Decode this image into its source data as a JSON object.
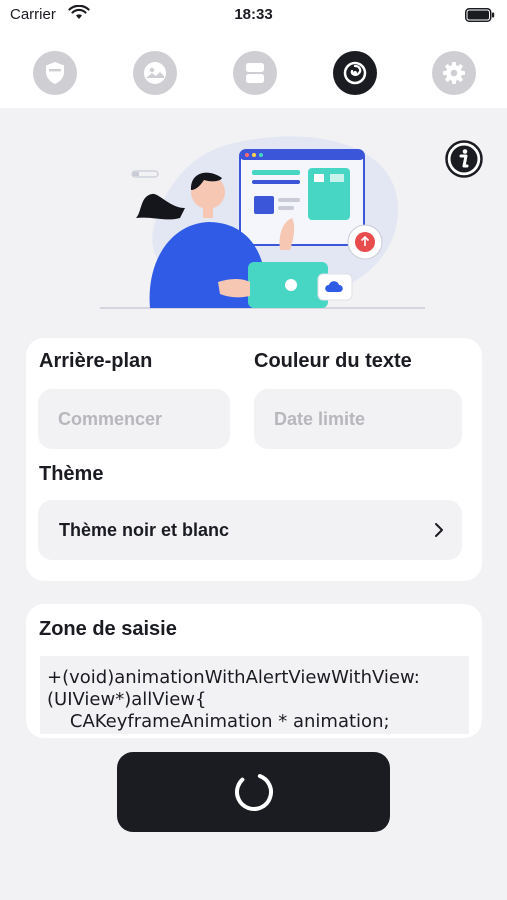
{
  "status_bar": {
    "carrier": "Carrier",
    "time": "18:33"
  },
  "tabs": [
    {
      "icon": "shield-icon",
      "active": false
    },
    {
      "icon": "image-icon",
      "active": false
    },
    {
      "icon": "layers-icon",
      "active": false
    },
    {
      "icon": "swirl-icon",
      "active": true
    },
    {
      "icon": "gear-icon",
      "active": false
    }
  ],
  "settings": {
    "background_label": "Arrière-plan",
    "background_placeholder": "Commencer",
    "text_color_label": "Couleur du texte",
    "text_color_placeholder": "Date limite",
    "theme_label": "Thème",
    "theme_value": "Thème noir et blanc"
  },
  "input_zone": {
    "label": "Zone de saisie",
    "lines": [
      "+(void)animationWithAlertViewWithView:",
      "(UIView*)allView{",
      "    CAKeyframeAnimation * animation;"
    ]
  },
  "colors": {
    "accent": "#1b1c22",
    "background": "#f2f2f4",
    "illustration_blue": "#2f5be6",
    "illustration_teal": "#47d6c4"
  }
}
